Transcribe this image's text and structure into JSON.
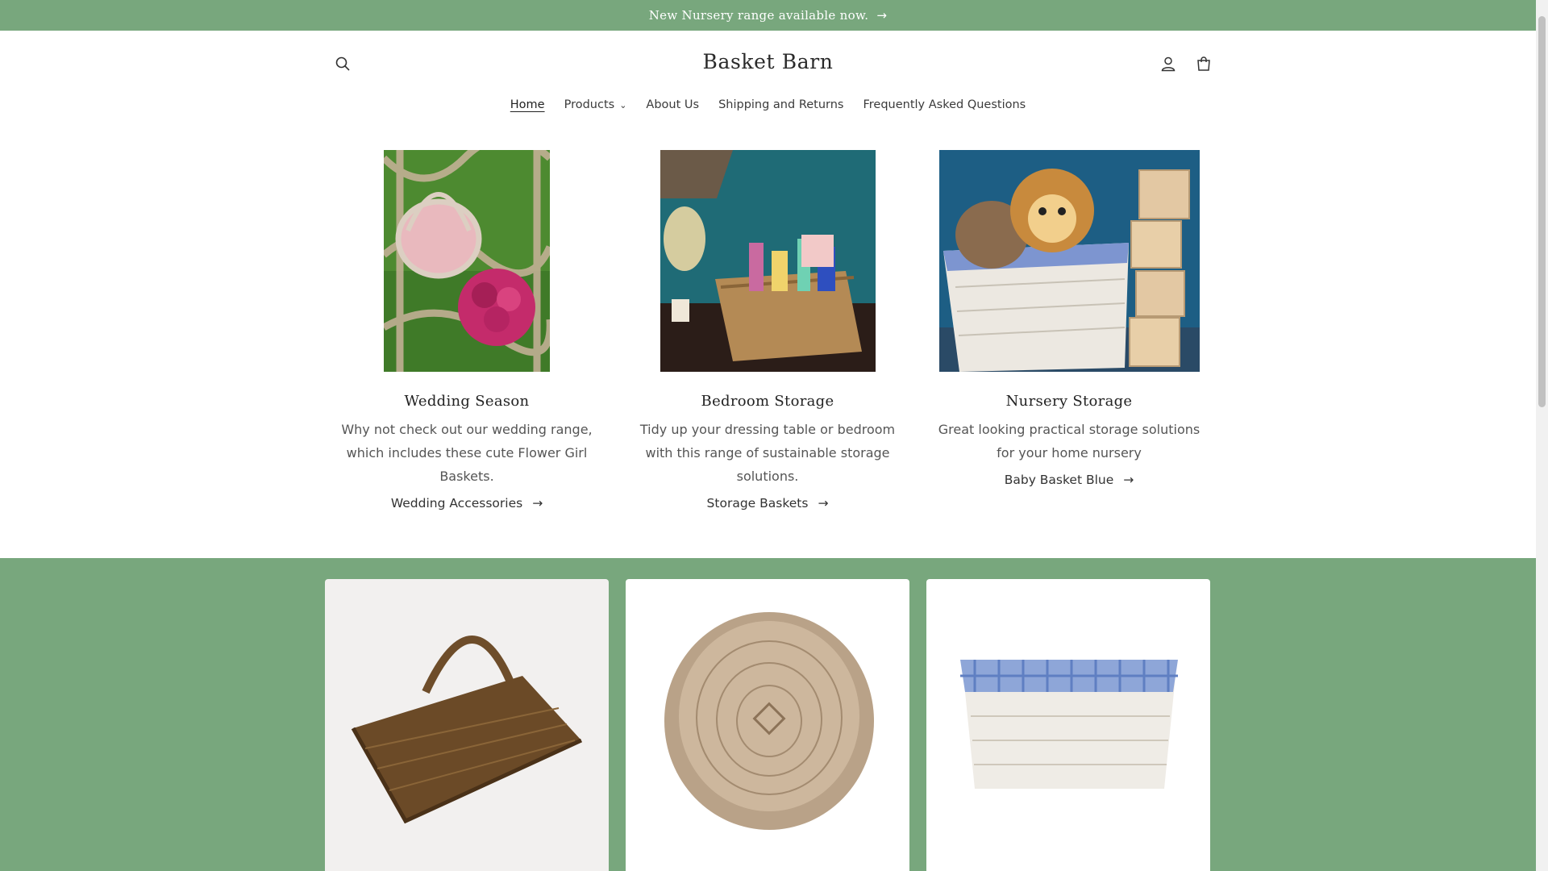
{
  "announcement": {
    "text": "New Nursery range available now.",
    "arrow": "→"
  },
  "header": {
    "logo": "Basket Barn",
    "icons": {
      "search": "search-icon",
      "account": "account-icon",
      "cart": "cart-icon"
    }
  },
  "nav": {
    "items": [
      {
        "label": "Home",
        "active": true
      },
      {
        "label": "Products",
        "has_dropdown": true
      },
      {
        "label": "About Us"
      },
      {
        "label": "Shipping and Returns"
      },
      {
        "label": "Frequently Asked Questions"
      }
    ]
  },
  "features": [
    {
      "title": "Wedding Season",
      "text": "Why not check out our wedding range, which includes these cute Flower Girl Baskets.",
      "link": "Wedding Accessories",
      "arrow": "→"
    },
    {
      "title": "Bedroom Storage",
      "text": "Tidy up your dressing table or bedroom with this range of sustainable storage solutions.",
      "link": "Storage Baskets",
      "arrow": "→"
    },
    {
      "title": "Nursery Storage",
      "text": "Great looking practical storage solutions for your home nursery",
      "link": "Baby Basket Blue",
      "arrow": "→"
    }
  ],
  "colors": {
    "brand_green": "#78a77d",
    "text": "#222222",
    "muted": "#555555"
  }
}
